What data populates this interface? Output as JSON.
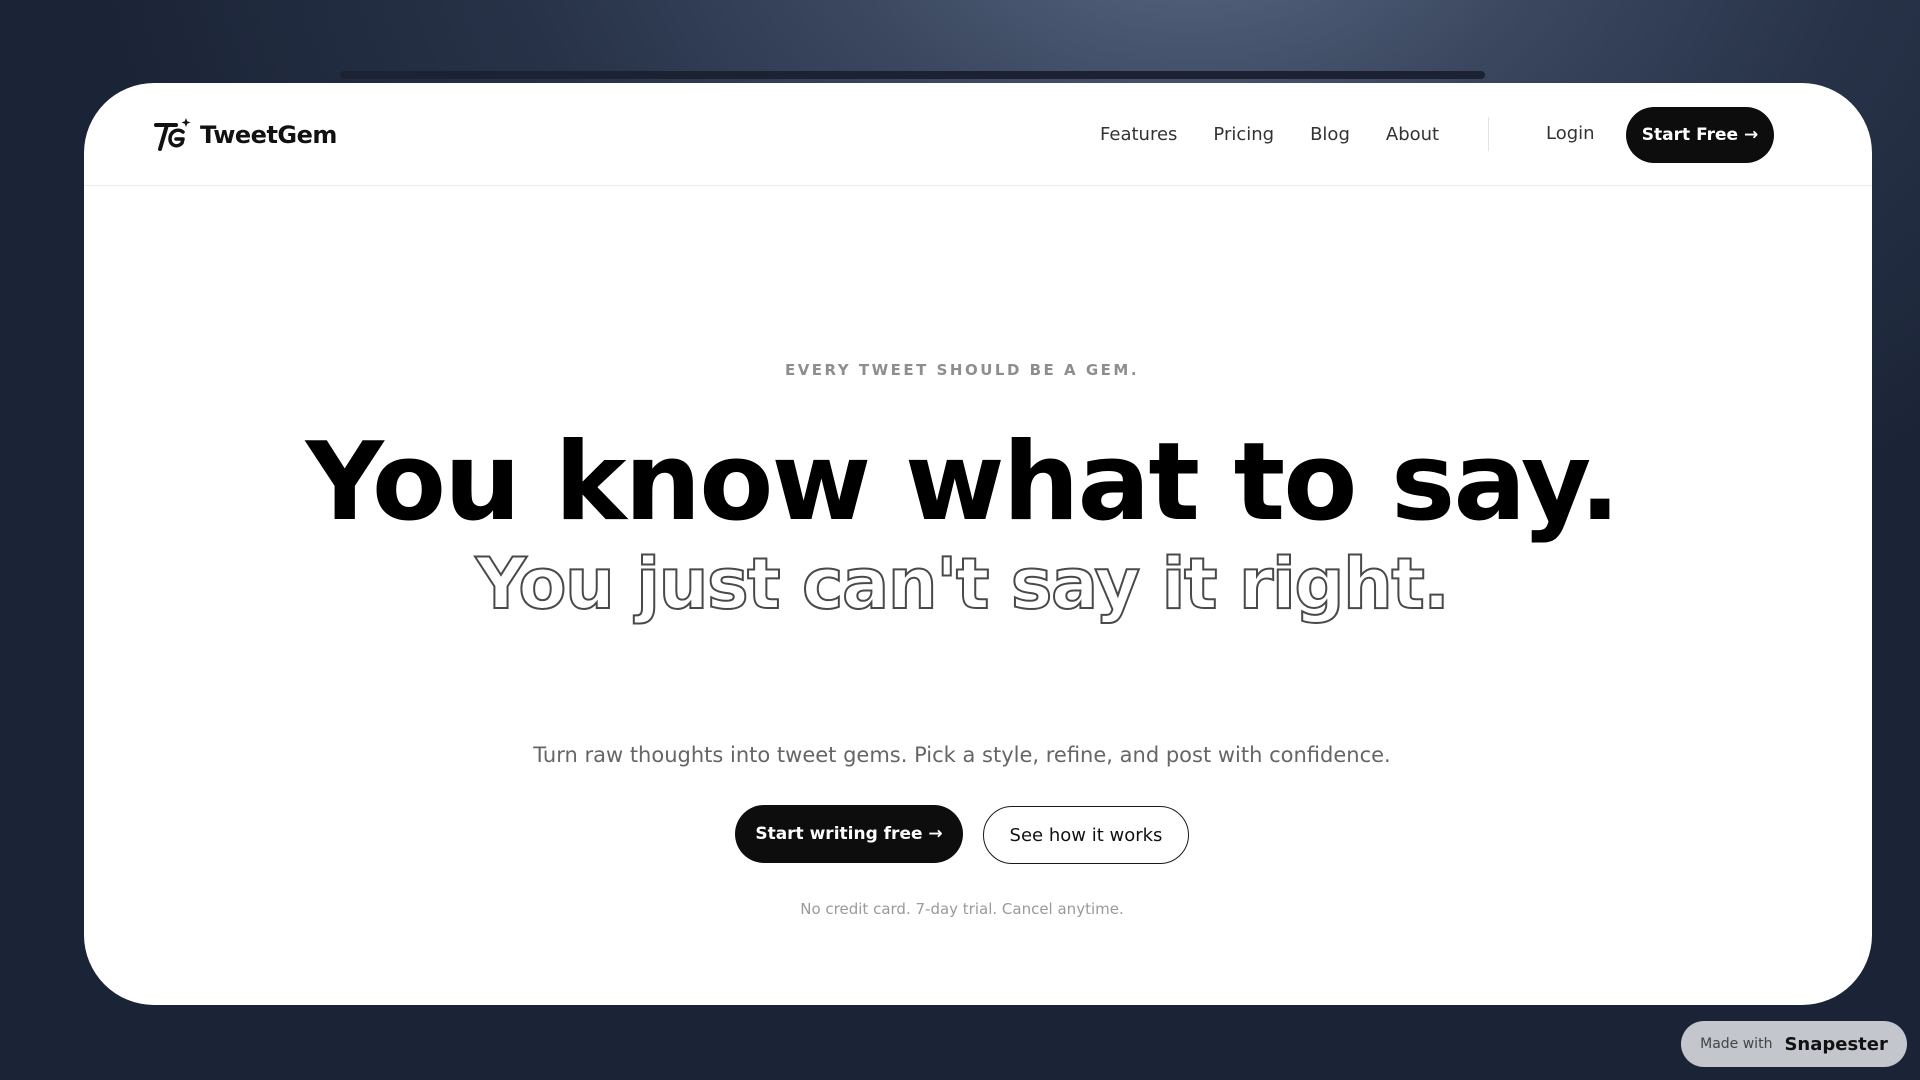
{
  "brand": {
    "name": "TweetGem",
    "logo_icon": "tg-monogram-sparkle-icon"
  },
  "nav": {
    "links": [
      "Features",
      "Pricing",
      "Blog",
      "About"
    ],
    "login_label": "Login",
    "start_free_label": "Start Free →"
  },
  "hero": {
    "eyebrow": "EVERY TWEET SHOULD BE A GEM.",
    "headline": "You know what to say.",
    "headline_outline": "You just can't say it right.",
    "subtitle": "Turn raw thoughts into tweet gems. Pick a style, refine, and post with confidence.",
    "primary_cta": "Start writing free →",
    "secondary_cta": "See how it works",
    "fine_print": "No credit card. 7-day trial. Cancel anytime."
  },
  "badge": {
    "label": "Made with",
    "brand": "Snapester"
  },
  "colors": {
    "accent": "#0d0d0d",
    "background": "#273248",
    "page": "#ffffff"
  }
}
